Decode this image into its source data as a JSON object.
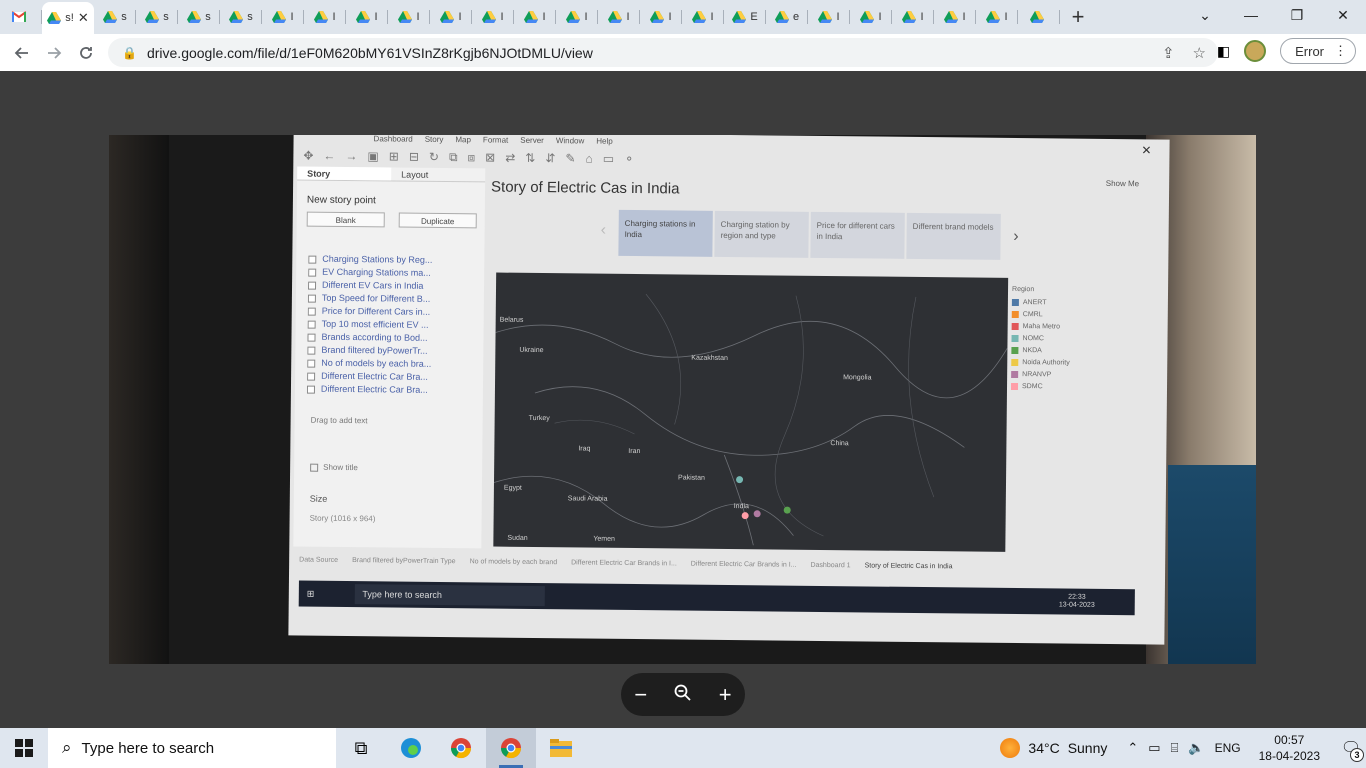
{
  "browser": {
    "tabs": [
      {
        "icon": "gmail-icon",
        "label": "",
        "active": false
      },
      {
        "icon": "drive-icon",
        "label": "s!",
        "active": true
      },
      {
        "icon": "drive-icon",
        "label": "s",
        "active": false
      },
      {
        "icon": "drive-icon",
        "label": "s",
        "active": false
      },
      {
        "icon": "drive-icon",
        "label": "s",
        "active": false
      },
      {
        "icon": "drive-icon",
        "label": "s",
        "active": false
      },
      {
        "icon": "drive-icon",
        "label": "I",
        "active": false
      },
      {
        "icon": "drive-icon",
        "label": "I",
        "active": false
      },
      {
        "icon": "drive-icon",
        "label": "I",
        "active": false
      },
      {
        "icon": "drive-icon",
        "label": "I",
        "active": false
      },
      {
        "icon": "drive-icon",
        "label": "I",
        "active": false
      },
      {
        "icon": "drive-icon",
        "label": "I",
        "active": false
      },
      {
        "icon": "drive-icon",
        "label": "I",
        "active": false
      },
      {
        "icon": "drive-icon",
        "label": "I",
        "active": false
      },
      {
        "icon": "drive-icon",
        "label": "I",
        "active": false
      },
      {
        "icon": "drive-icon",
        "label": "I",
        "active": false
      },
      {
        "icon": "drive-icon",
        "label": "I",
        "active": false
      },
      {
        "icon": "drive-icon",
        "label": "E",
        "active": false
      },
      {
        "icon": "drive-icon",
        "label": "e",
        "active": false
      },
      {
        "icon": "drive-icon",
        "label": "I",
        "active": false
      },
      {
        "icon": "drive-icon",
        "label": "I",
        "active": false
      },
      {
        "icon": "drive-icon",
        "label": "I",
        "active": false
      },
      {
        "icon": "drive-icon",
        "label": "I",
        "active": false
      },
      {
        "icon": "drive-icon",
        "label": "I",
        "active": false
      },
      {
        "icon": "drive-icon",
        "label": "",
        "active": false
      }
    ],
    "url": "drive.google.com/file/d/1eF0M620bMY61VSInZ8rKgjb6NJOtDMLU/view",
    "error_label": "Error",
    "new_tab": "+",
    "window_min": "—",
    "window_max": "❐",
    "window_close": "✕",
    "tab_close": "✕",
    "tab_dropdown": "⌄"
  },
  "photo": {
    "menu": [
      "Dashboard",
      "Story",
      "Map",
      "Format",
      "Server",
      "Window",
      "Help"
    ],
    "close_glyph": "✕",
    "pane_tabs": [
      "Story",
      "Layout"
    ],
    "new_story_point": "New story point",
    "blank_button": "Blank",
    "duplicate_button": "Duplicate",
    "sheets": [
      "Charging Stations by Reg...",
      "EV Charging Stations ma...",
      "Different EV Cars in India",
      "Top Speed for Different B...",
      "Price for Different Cars in...",
      "Top 10 most efficient EV ...",
      "Brands according to Bod...",
      "Brand filtered byPowerTr...",
      "No of models by each bra...",
      "Different Electric Car Bra...",
      "Different Electric Car Bra..."
    ],
    "drag_text": "Drag to add text",
    "show_title": "Show title",
    "size_label": "Size",
    "size_value": "Story (1016 x 964)",
    "story_title": "Story of Electric Cas in India",
    "show_me": "Show Me",
    "story_points": [
      "Charging stations in India",
      "Charging station by region and type",
      "Price for different cars in India",
      "Different brand models"
    ],
    "map_labels": [
      "Belarus",
      "Ukraine",
      "Kazakhstan",
      "Mongolia",
      "Turkey",
      "Iraq",
      "Iran",
      "China",
      "Pakistan",
      "Egypt",
      "Saudi Arabia",
      "India",
      "Sudan",
      "Yemen"
    ],
    "legend_title": "Region",
    "legend": [
      {
        "name": "ANERT",
        "color": "#4e79a7"
      },
      {
        "name": "CMRL",
        "color": "#f28e2b"
      },
      {
        "name": "Maha Metro",
        "color": "#e15759"
      },
      {
        "name": "NOMC",
        "color": "#76b7b2"
      },
      {
        "name": "NKDA",
        "color": "#59a14f"
      },
      {
        "name": "Noida Authority",
        "color": "#edc948"
      },
      {
        "name": "NRANVP",
        "color": "#b07aa1"
      },
      {
        "name": "SDMC",
        "color": "#ff9da7"
      }
    ],
    "sheet_tabs": [
      "Data Source",
      "Brand filtered byPowerTrain Type",
      "No of models by each brand",
      "Different Electric Car Brands in I...",
      "Different Electric Car Brands in I...",
      "Dashboard 1",
      "Story of Electric Cas in India"
    ],
    "inner_search": "Type here to search",
    "inner_time": "22:33",
    "inner_date": "13-04-2023"
  },
  "zoom": {
    "out": "−",
    "icon": "zoom-icon",
    "in": "+"
  },
  "taskbar": {
    "search_placeholder": "Type here to search",
    "weather_temp": "34°C",
    "weather_text": "Sunny",
    "language": "ENG",
    "time": "00:57",
    "date": "18-04-2023",
    "notifications": "3"
  }
}
